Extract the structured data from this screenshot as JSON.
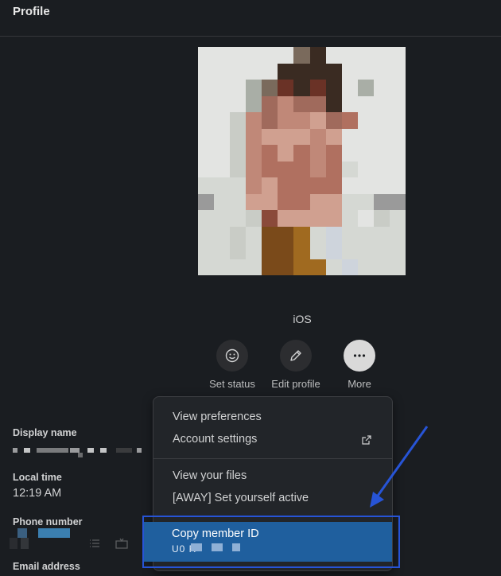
{
  "header": {
    "title": "Profile"
  },
  "profile": {
    "status_text": "iOS"
  },
  "actions": [
    {
      "label": "Set status",
      "icon": "smile-icon"
    },
    {
      "label": "Edit profile",
      "icon": "pencil-icon"
    },
    {
      "label": "More",
      "icon": "more-icon"
    }
  ],
  "fields": {
    "display_name": {
      "label": "Display name"
    },
    "local_time": {
      "label": "Local time",
      "value": "12:19 AM"
    },
    "phone": {
      "label": "Phone number"
    },
    "email": {
      "label": "Email address"
    }
  },
  "menu": {
    "view_preferences": "View preferences",
    "account_settings": "Account settings",
    "view_files": "View your files",
    "set_active": "[AWAY] Set yourself active",
    "copy_member_id": "Copy member ID",
    "member_id": "U0          R"
  },
  "colors": {
    "background": "#1a1d21",
    "menu_bg": "#222529",
    "highlight": "#1f5f9e",
    "annotation": "#2754d6"
  }
}
